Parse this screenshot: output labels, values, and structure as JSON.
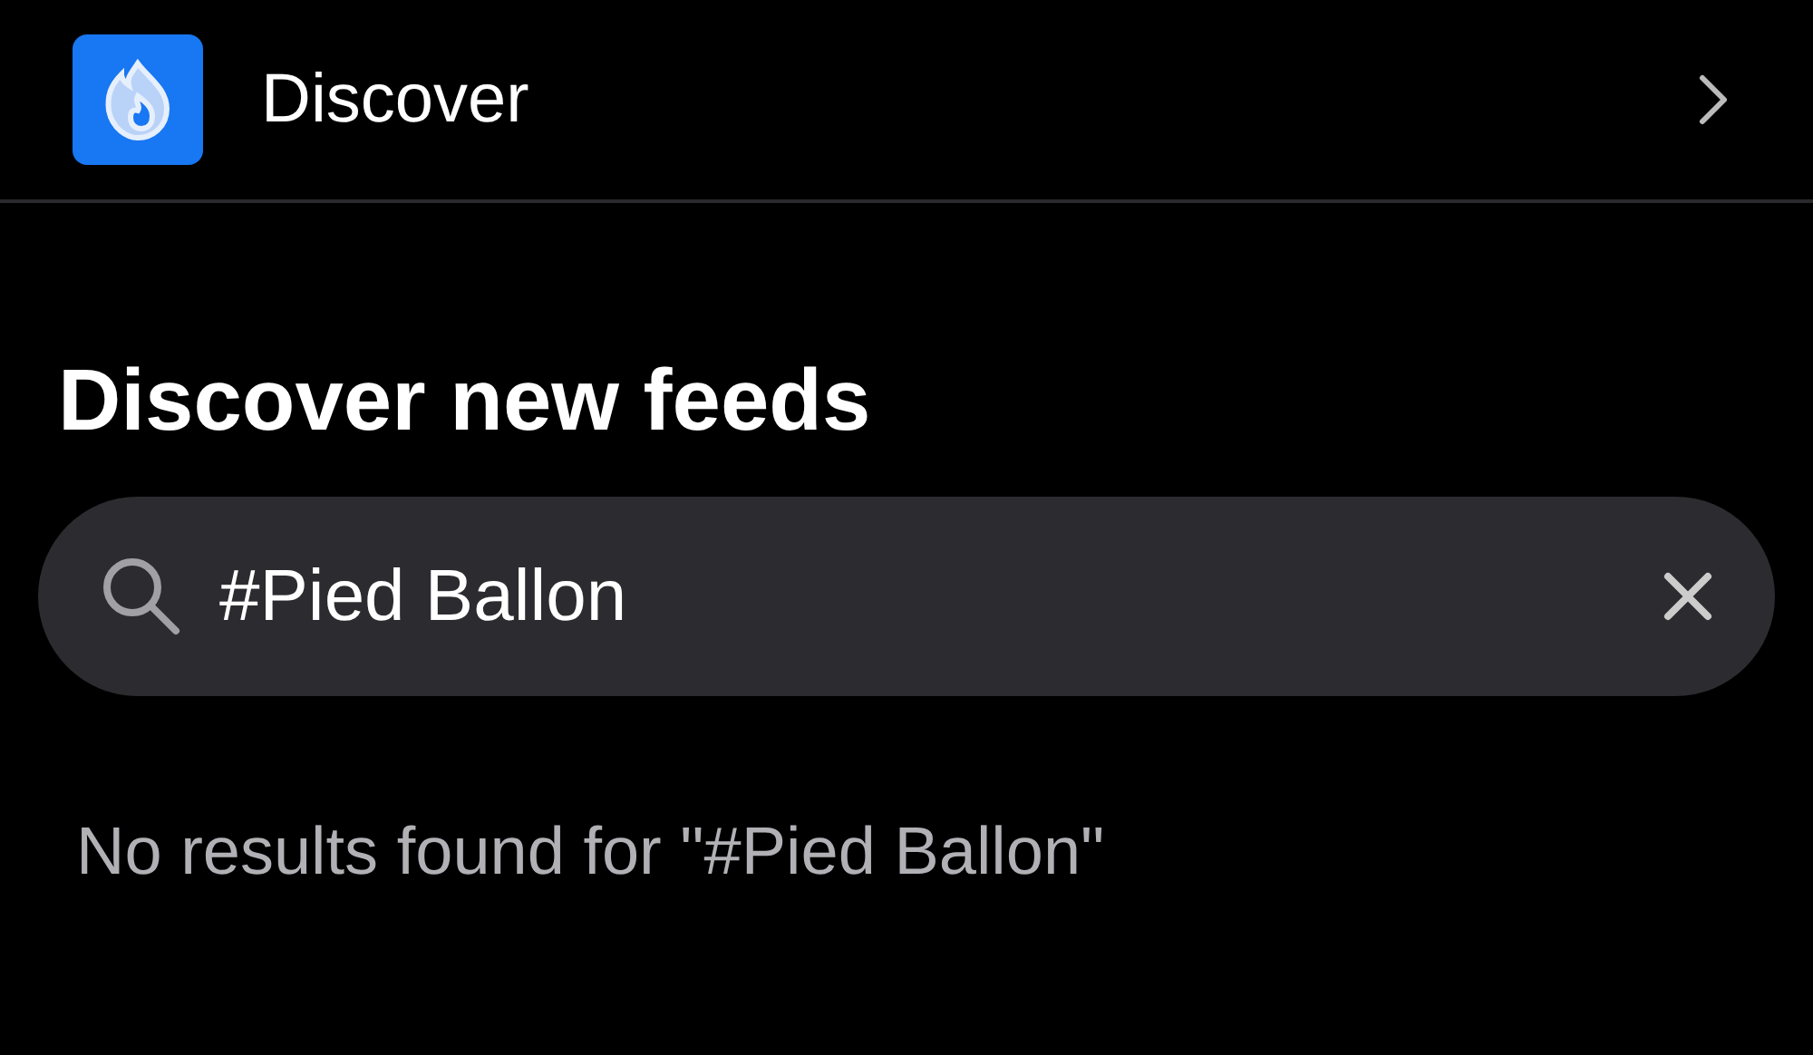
{
  "header": {
    "title": "Discover"
  },
  "heading": "Discover new feeds",
  "search": {
    "value": "#Pied Ballon"
  },
  "message": "No results found for \"#Pied Ballon\""
}
